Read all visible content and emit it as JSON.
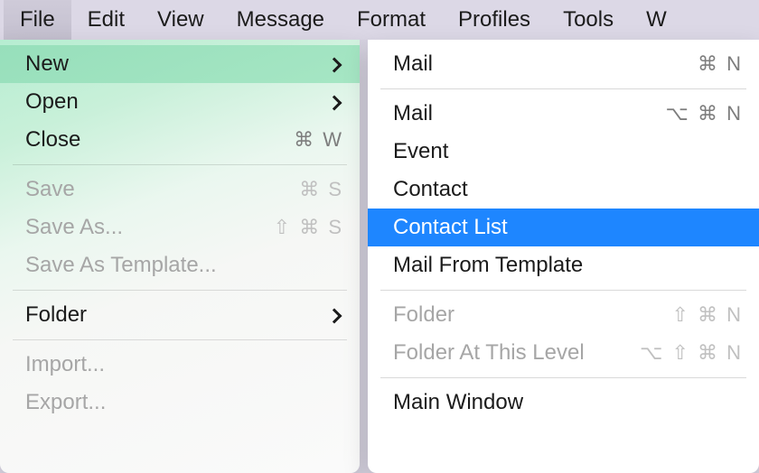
{
  "menubar": {
    "items": [
      {
        "label": "File",
        "selected": true
      },
      {
        "label": "Edit"
      },
      {
        "label": "View"
      },
      {
        "label": "Message"
      },
      {
        "label": "Format"
      },
      {
        "label": "Profiles"
      },
      {
        "label": "Tools"
      },
      {
        "label": "W"
      }
    ]
  },
  "fileMenu": {
    "new_label": "New",
    "open_label": "Open",
    "close_label": "Close",
    "close_shortcut": "⌘ W",
    "save_label": "Save",
    "save_shortcut": "⌘ S",
    "saveas_label": "Save As...",
    "saveas_shortcut": "⇧ ⌘ S",
    "saveastemplate_label": "Save As Template...",
    "folder_label": "Folder",
    "import_label": "Import...",
    "export_label": "Export..."
  },
  "newMenu": {
    "mail1_label": "Mail",
    "mail1_shortcut": "⌘ N",
    "mail2_label": "Mail",
    "mail2_shortcut": "⌥ ⌘ N",
    "event_label": "Event",
    "contact_label": "Contact",
    "contactlist_label": "Contact List",
    "mailtemplate_label": "Mail From Template",
    "folder_label": "Folder",
    "folder_shortcut": "⇧ ⌘ N",
    "folderlevel_label": "Folder At This Level",
    "folderlevel_shortcut": "⌥ ⇧ ⌘ N",
    "mainwindow_label": "Main Window"
  }
}
